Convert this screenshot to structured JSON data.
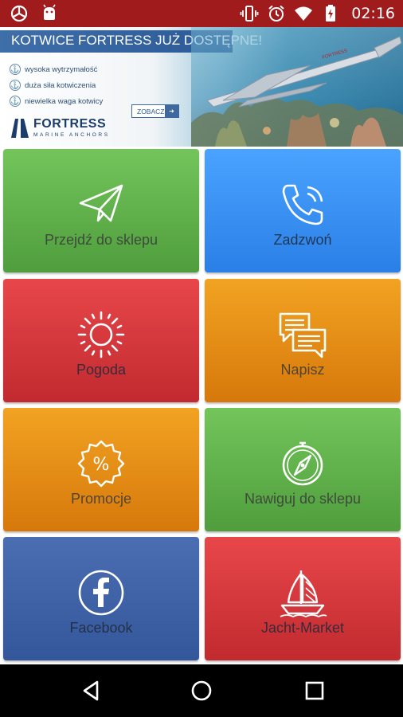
{
  "status_bar": {
    "time": "02:16",
    "bg_color": "#a01c1c",
    "left_icons": [
      "app-notification-icon",
      "android-icon"
    ],
    "right_icons": [
      "vibrate-icon",
      "alarm-icon",
      "wifi-icon",
      "battery-charging-icon"
    ]
  },
  "banner": {
    "headline": "KOTWICE FORTRESS JUŻ DOSTĘPNE!",
    "features": [
      "wysoka wytrzymałość",
      "duża siła kotwiczenia",
      "niewielka waga kotwicy"
    ],
    "cta": "ZOBACZ",
    "brand": "FORTRESS",
    "brand_sub": "MARINE ANCHORS",
    "anchor_text": "FORTRESS"
  },
  "tiles": [
    {
      "label": "Przejdź do sklepu",
      "icon": "paper-plane-icon",
      "color": "green"
    },
    {
      "label": "Zadzwoń",
      "icon": "phone-icon",
      "color": "blue"
    },
    {
      "label": "Pogoda",
      "icon": "sun-icon",
      "color": "red"
    },
    {
      "label": "Napisz",
      "icon": "chat-bubbles-icon",
      "color": "orange"
    },
    {
      "label": "Promocje",
      "icon": "percent-badge-icon",
      "color": "orange"
    },
    {
      "label": "Nawiguj do sklepu",
      "icon": "compass-icon",
      "color": "green"
    },
    {
      "label": "Facebook",
      "icon": "facebook-icon",
      "color": "fbblue"
    },
    {
      "label": "Jacht-Market",
      "icon": "sailboat-icon",
      "color": "red"
    }
  ],
  "nav_bar": {
    "buttons": [
      "back-icon",
      "home-icon",
      "recents-icon"
    ]
  }
}
